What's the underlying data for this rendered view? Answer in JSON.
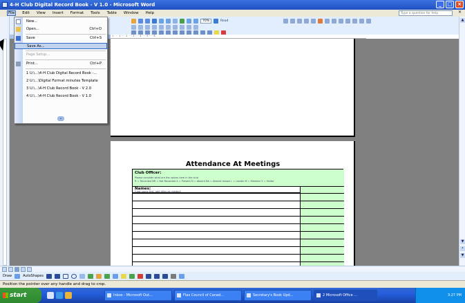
{
  "window": {
    "title": "4-H Club Digital Record Book - V 1.0 - Microsoft Word",
    "minimize": "_",
    "maximize": "□",
    "close": "×"
  },
  "menubar": {
    "items": [
      "File",
      "Edit",
      "View",
      "Insert",
      "Format",
      "Tools",
      "Table",
      "Window",
      "Help"
    ],
    "ask_placeholder": "Type a question for help",
    "close_doc": "×"
  },
  "toolbar": {
    "zoom": "70%",
    "read_label": "Read"
  },
  "ruler_text": "· 1 · · · 1 · · · 2 · · · 3 · · · 4 · · · 5 · · · 6",
  "file_menu": {
    "items": [
      {
        "label": "New...",
        "shortcut": "",
        "icon": "new-document-icon",
        "disabled": false
      },
      {
        "label": "Open...",
        "shortcut": "Ctrl+O",
        "icon": "open-folder-icon",
        "disabled": false
      },
      {
        "label": "Save",
        "shortcut": "Ctrl+S",
        "icon": "save-disk-icon",
        "disabled": false
      },
      {
        "label": "Save As...",
        "shortcut": "",
        "icon": "",
        "disabled": false,
        "highlighted": true
      },
      {
        "label": "Page Setup...",
        "shortcut": "",
        "icon": "",
        "disabled": true
      },
      {
        "label": "Print...",
        "shortcut": "Ctrl+P",
        "icon": "print-icon",
        "disabled": false
      },
      {
        "label": "1 U:\\...\\4-H Club Digital Record Book -...",
        "shortcut": "",
        "icon": "",
        "disabled": false
      },
      {
        "label": "2 U:\\...\\Digital Format minutes Template",
        "shortcut": "",
        "icon": "",
        "disabled": false
      },
      {
        "label": "3 U:\\...\\4-H Club Record Book - V 2.0",
        "shortcut": "",
        "icon": "",
        "disabled": false
      },
      {
        "label": "4 U:\\...\\4-H Club Record Book - V 1.0",
        "shortcut": "",
        "icon": "",
        "disabled": false
      }
    ],
    "expand": "⌄"
  },
  "document": {
    "heading": "Attendance At Meetings",
    "club_officer_label": "Club Officer:",
    "officer_note": "Please consider what are the values here in the club",
    "officer_legend": "R = Recorded   NR = Not Recorded   A = Present   N = Absent   BA = Absent reason   L = Leader   M = Member   V = Visitor",
    "names_label": "Names:",
    "names_note": "(Last name first, add titles as needed)"
  },
  "drawbar": {
    "draw_label": "Draw",
    "autoshapes_label": "AutoShapes"
  },
  "statusbar": {
    "text": "Position the pointer over any handle and drag to crop."
  },
  "taskbar": {
    "start_label": "start",
    "buttons": [
      "Inbox - Microsoft Out...",
      "Flax Council of Canad...",
      "Secretary's Book Upd...",
      "2 Microsoft Office ..."
    ],
    "clock": "3:27 PM"
  },
  "colors": {
    "titlebar": "#245edb",
    "form_green": "#ccffcc",
    "taskbar": "#245edb",
    "start_green": "#3c9a3c"
  }
}
